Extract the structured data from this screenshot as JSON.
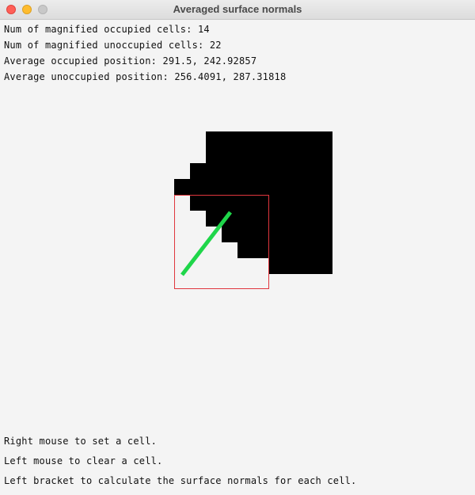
{
  "window": {
    "title": "Averaged surface normals"
  },
  "stats": {
    "occupied_count": "Num of magnified occupied cells: 14",
    "unoccupied_count": "Num of magnified unoccupied cells: 22",
    "avg_occupied": "Average occupied position: 291.5, 242.92857",
    "avg_unoccupied": "Average unoccupied position: 256.4091, 287.31818"
  },
  "instructions": {
    "right_mouse": "Right mouse to set a cell.",
    "left_mouse": "Left mouse to clear a cell.",
    "left_bracket": "Left bracket to calculate the surface normals for each cell."
  },
  "colors": {
    "occupied_cell": "#000000",
    "magnify_border": "#e0363d",
    "normal_line": "#1fd64a",
    "background": "#f4f4f4"
  }
}
